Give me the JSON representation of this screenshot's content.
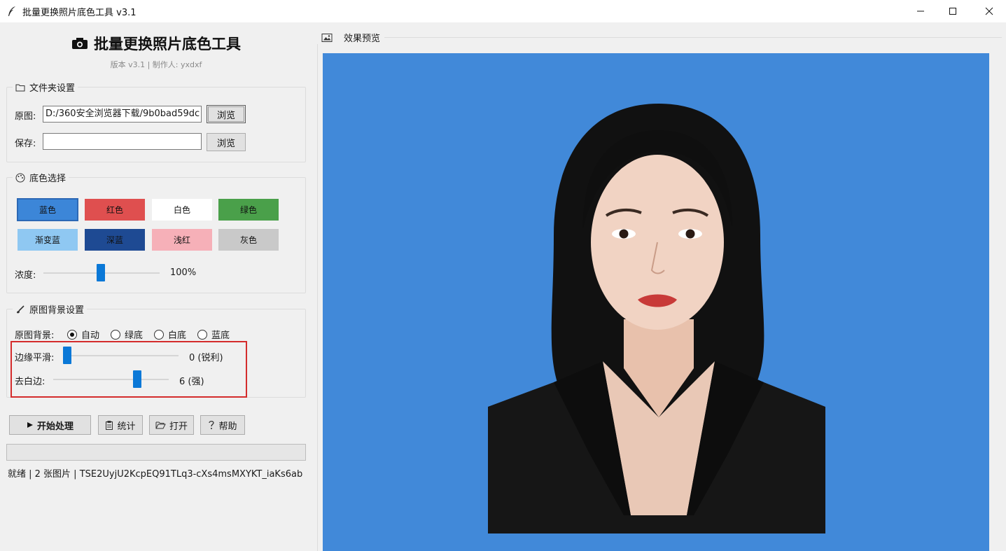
{
  "window": {
    "title": "批量更换照片底色工具 v3.1"
  },
  "header": {
    "title": "批量更换照片底色工具",
    "subtitle": "版本 v3.1 | 制作人: yxdxf"
  },
  "folder_settings": {
    "title": "文件夹设置",
    "source_label": "原图:",
    "source_value": "D:/360安全浏览器下载/9b0bad59dc",
    "save_label": "保存:",
    "save_value": "",
    "browse_label": "浏览"
  },
  "color_select": {
    "title": "底色选择",
    "swatches": [
      {
        "label": "蓝色",
        "color": "#3c86d8",
        "selected": true
      },
      {
        "label": "红色",
        "color": "#df4f4f"
      },
      {
        "label": "白色",
        "color": "#ffffff"
      },
      {
        "label": "绿色",
        "color": "#4aa04a"
      },
      {
        "label": "渐变蓝",
        "color": "#8fc8f2"
      },
      {
        "label": "深蓝",
        "color": "#1e4a93"
      },
      {
        "label": "浅红",
        "color": "#f6b0b8"
      },
      {
        "label": "灰色",
        "color": "#c9c9c9"
      }
    ],
    "density_label": "浓度:",
    "density_value": "100%",
    "density_level": 1.0
  },
  "bg_settings": {
    "title": "原图背景设置",
    "bg_label": "原图背景:",
    "options": [
      "自动",
      "绿底",
      "白底",
      "蓝底"
    ],
    "selected_option": "自动",
    "edge_label": "边缘平滑:",
    "edge_value": "0 (锐利)",
    "edge_level": 0,
    "trim_label": "去白边:",
    "trim_value": "6 (强)",
    "trim_level": 6
  },
  "actions": {
    "start": "开始处理",
    "stats": "统计",
    "open": "打开",
    "help": "帮助"
  },
  "status": {
    "text": "就绪 | 2 张图片 | TSE2UyjU2KcpEQ91TLq3-cXs4msMXYKT_iaKs6ab"
  },
  "preview": {
    "title": "效果预览",
    "background_color": "#4189d9"
  },
  "icons": {
    "app": "feather-icon",
    "camera": "camera-icon",
    "folder": "folder-icon",
    "palette": "palette-icon",
    "brush": "brush-icon",
    "play": "play-icon",
    "stats": "clipboard-icon",
    "open": "open-folder-icon",
    "help": "help-icon",
    "preview": "image-icon"
  }
}
